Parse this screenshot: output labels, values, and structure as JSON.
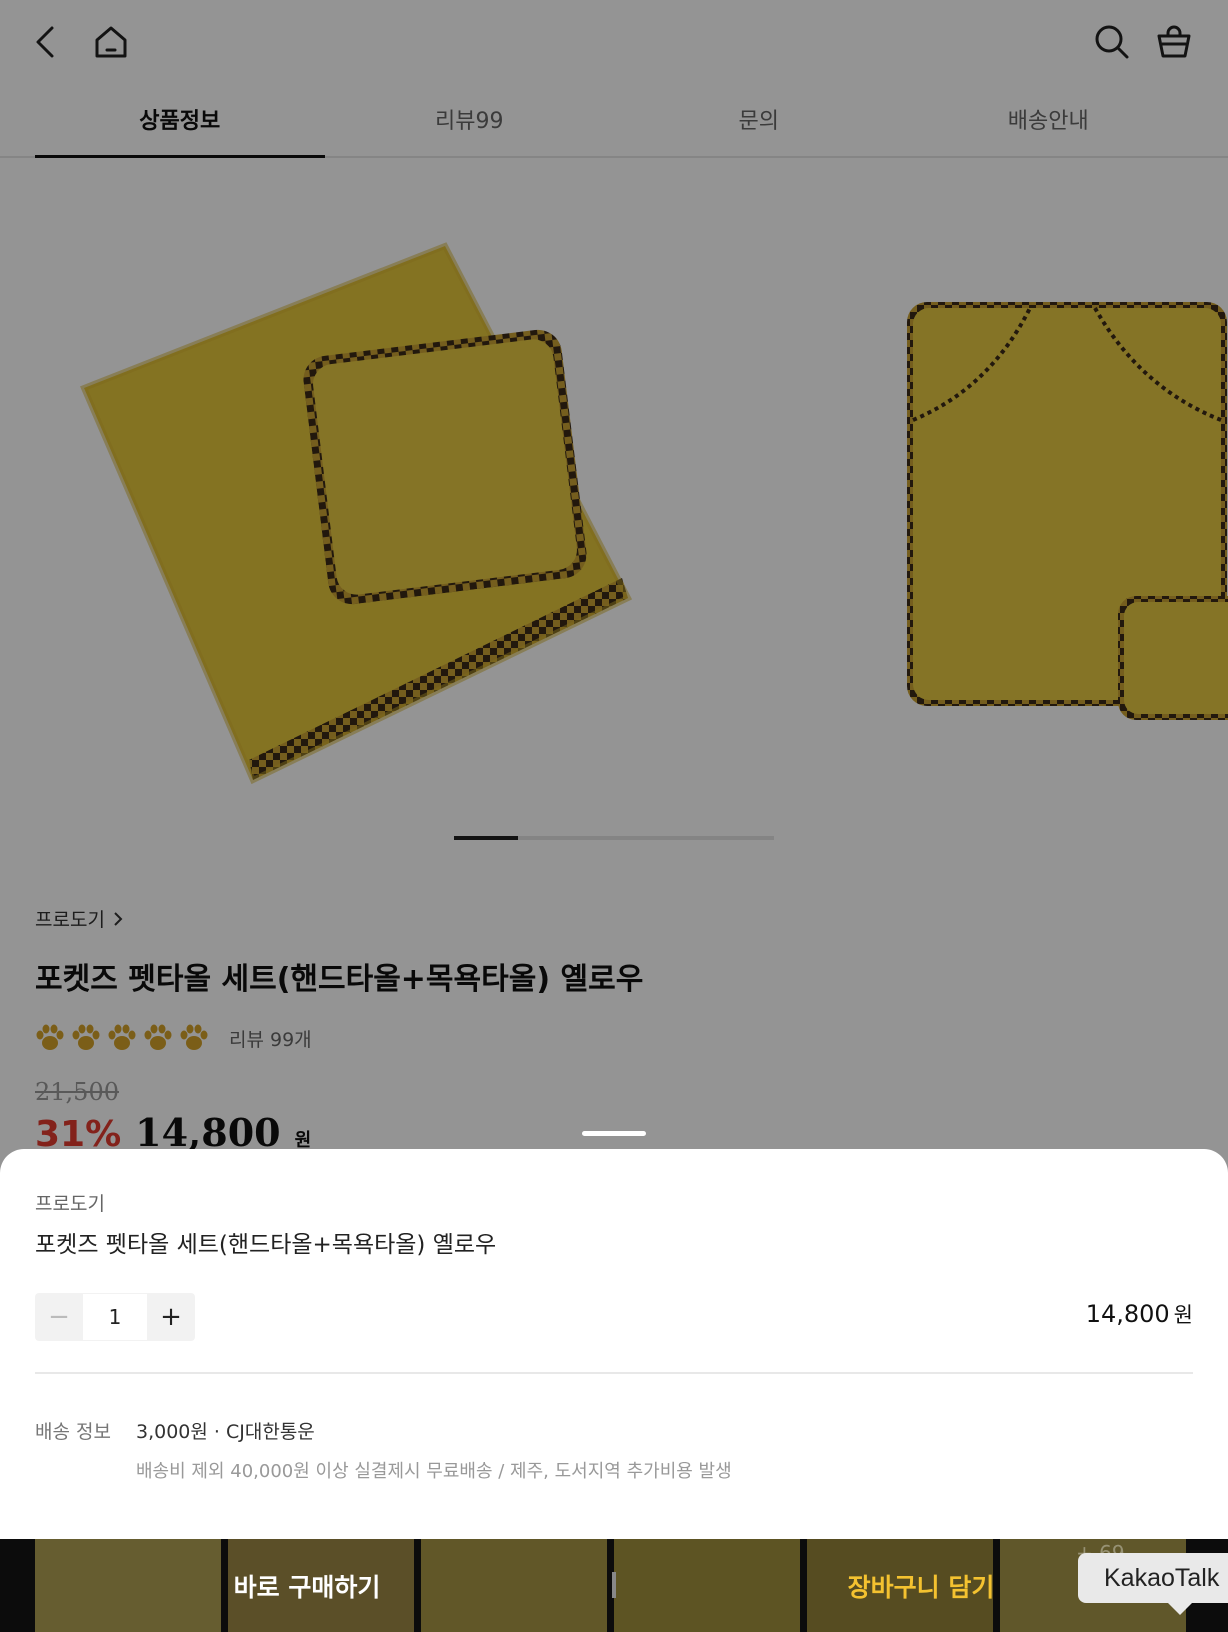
{
  "tabs": [
    {
      "label": "상품정보",
      "active": true
    },
    {
      "label": "리뷰99",
      "active": false
    },
    {
      "label": "문의",
      "active": false
    },
    {
      "label": "배송안내",
      "active": false
    }
  ],
  "gallery": {
    "current_slide": 1,
    "total_slides": 5
  },
  "product": {
    "brand": "프로도기",
    "title": "포켓즈 펫타올 세트(핸드타올+목욕타올) 옐로우",
    "rating_paws": 5,
    "review_count": "리뷰 99개",
    "original_price": "21,500",
    "discount": "31%",
    "sale_price": "14,800",
    "won": "원"
  },
  "sheet": {
    "brand": "프로도기",
    "product_name": "포켓즈 펫타올 세트(핸드타올+목욕타올) 옐로우",
    "minus": "−",
    "quantity": "1",
    "plus": "+",
    "item_price": "14,800",
    "item_price_unit": "원",
    "shipping_label": "배송 정보",
    "shipping_main": "3,000원 · CJ대한통운",
    "shipping_sub": "배송비 제외 40,000원 이상 실결제시 무료배송 / 제주, 도서지역 추가비용 발생"
  },
  "actions": {
    "buy_now": "바로 구매하기",
    "add_to_cart": "장바구니 담기",
    "more_count": "+ 69"
  },
  "kakao_tooltip": "KakaoTalk",
  "colors": {
    "discount": "#e23b30",
    "cart_button_text": "#f4c230",
    "towel": "#e7c93b",
    "paw": "#d4a22a"
  }
}
